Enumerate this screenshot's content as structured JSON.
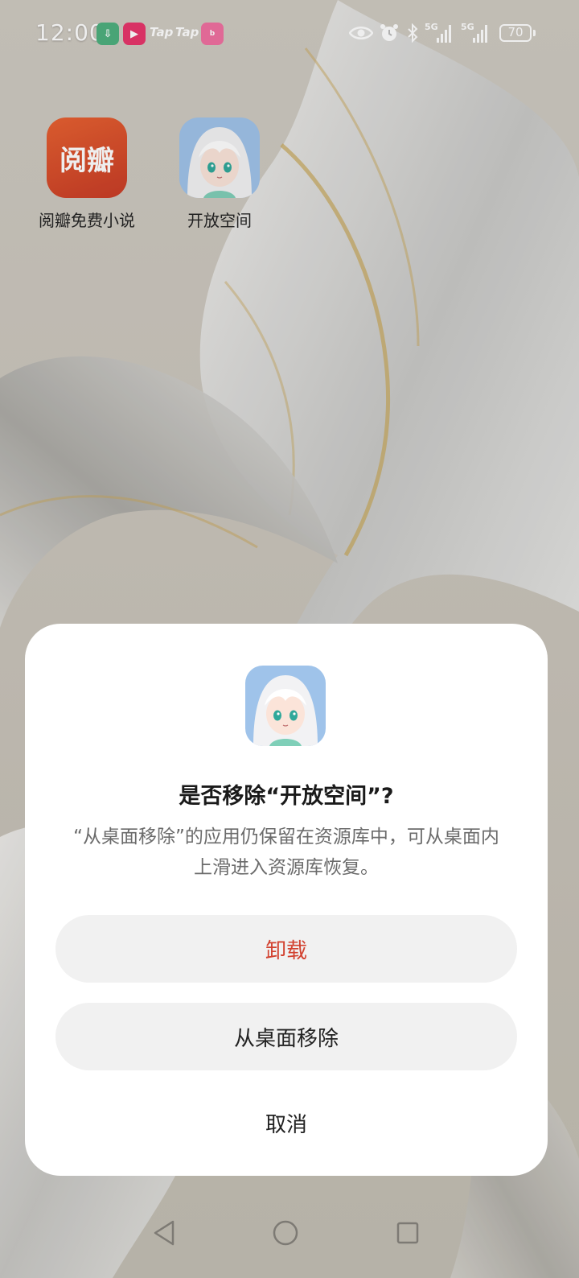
{
  "status_bar": {
    "time": "12:00",
    "tap_label_1": "Tap",
    "tap_label_2": "Tap",
    "battery": "70",
    "network_1": "5G",
    "network_2": "5G"
  },
  "home": {
    "apps": [
      {
        "label": "阅瓣免费小说",
        "icon_text": "阅瓣",
        "icon": "yueban-app-icon",
        "color": "#d9492a"
      },
      {
        "label": "开放空间",
        "icon": "anime-girl-app-icon"
      }
    ]
  },
  "dialog": {
    "icon": "anime-girl-app-icon",
    "title": "是否移除“开放空间”?",
    "message": "“从桌面移除”的应用仍保留在资源库中，可从桌面内上滑进入资源库恢复。",
    "uninstall_label": "卸载",
    "remove_label": "从桌面移除",
    "cancel_label": "取消",
    "uninstall_color": "#d2412f"
  },
  "nav": {
    "back": "back-icon",
    "home": "home-icon",
    "recents": "recents-icon"
  }
}
